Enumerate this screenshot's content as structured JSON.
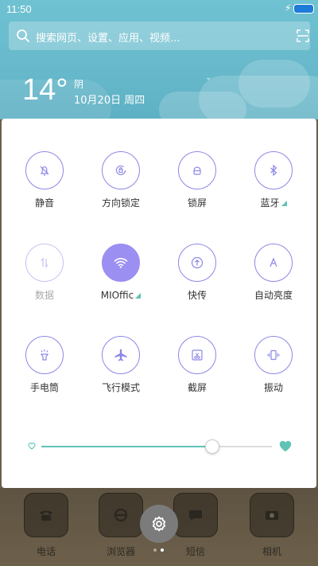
{
  "status_bar": {
    "time": "11:50"
  },
  "search": {
    "placeholder": "搜索网页、设置、应用、视频..."
  },
  "weather": {
    "temperature": "14°",
    "condition": "阴",
    "date": "10月20日 周四"
  },
  "toggles": [
    {
      "id": "mute",
      "label": "静音",
      "icon": "bell-off-icon",
      "state": "off"
    },
    {
      "id": "rotation-lock",
      "label": "方向锁定",
      "icon": "rotation-lock-icon",
      "state": "off"
    },
    {
      "id": "lock-screen",
      "label": "锁屏",
      "icon": "lock-icon",
      "state": "off"
    },
    {
      "id": "bluetooth",
      "label": "蓝牙",
      "icon": "bluetooth-icon",
      "state": "off",
      "has_more": true
    },
    {
      "id": "data",
      "label": "数据",
      "icon": "mobile-data-icon",
      "state": "disabled"
    },
    {
      "id": "wifi",
      "label": "MIOffic",
      "icon": "wifi-icon",
      "state": "on",
      "has_more": true
    },
    {
      "id": "quick-transfer",
      "label": "快传",
      "icon": "upload-icon",
      "state": "off"
    },
    {
      "id": "auto-brightness",
      "label": "自动亮度",
      "icon": "auto-brightness-icon",
      "state": "off"
    },
    {
      "id": "flashlight",
      "label": "手电筒",
      "icon": "flashlight-icon",
      "state": "off"
    },
    {
      "id": "airplane",
      "label": "飞行模式",
      "icon": "airplane-icon",
      "state": "off"
    },
    {
      "id": "screenshot",
      "label": "截屏",
      "icon": "screenshot-icon",
      "state": "off"
    },
    {
      "id": "vibrate",
      "label": "振动",
      "icon": "vibrate-icon",
      "state": "off"
    }
  ],
  "brightness": {
    "level": 0.74
  },
  "dock": [
    {
      "label": "电话",
      "icon": "phone-icon"
    },
    {
      "label": "浏览器",
      "icon": "browser-icon"
    },
    {
      "label": "短信",
      "icon": "message-icon"
    },
    {
      "label": "相机",
      "icon": "camera-icon"
    }
  ],
  "pager": {
    "pages": 2,
    "current": 1
  },
  "colors": {
    "accent": "#9c8ff2",
    "slider": "#5fc3b6",
    "sky": "#6fc2d2"
  }
}
